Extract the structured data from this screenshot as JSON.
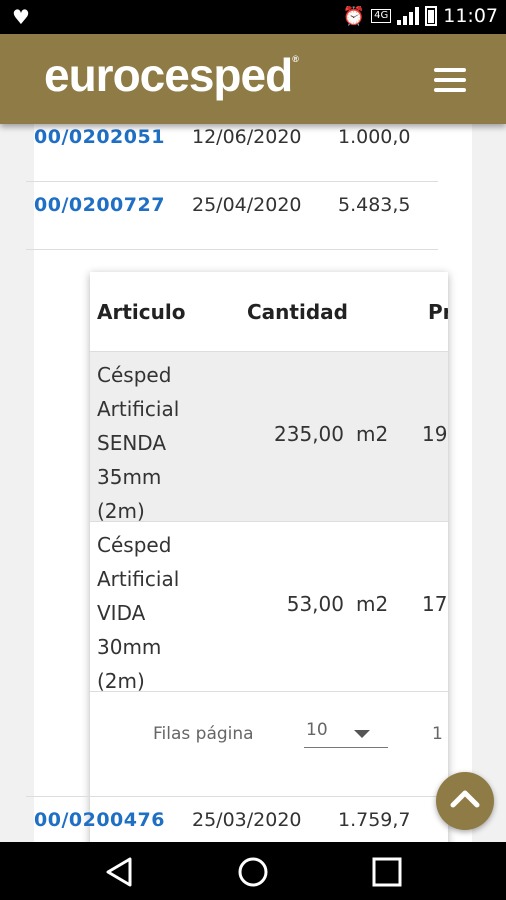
{
  "statusbar": {
    "time": "11:07",
    "network": "4G"
  },
  "header": {
    "brand": "eurocesped",
    "registered_mark": "®"
  },
  "orders": [
    {
      "number": "00/0202051",
      "date": "12/06/2020",
      "amount": "1.000,0"
    },
    {
      "number": "00/0200727",
      "date": "25/04/2020",
      "amount": "5.483,5"
    },
    {
      "number": "00/0200476",
      "date": "25/03/2020",
      "amount": "1.759,7"
    }
  ],
  "detail": {
    "columns": {
      "articulo": "Articulo",
      "cantidad": "Cantidad",
      "precio": "Pr"
    },
    "items": [
      {
        "lines": [
          "Césped",
          "Artificial",
          "SENDA",
          "35mm",
          "(2m)"
        ],
        "quantity": "235,00",
        "unit": "m2",
        "price": "19"
      },
      {
        "lines": [
          "Césped",
          "Artificial",
          "VIDA",
          "30mm",
          "(2m)"
        ],
        "quantity": "53,00",
        "unit": "m2",
        "price": "17"
      }
    ],
    "pagination": {
      "rows_label": "Filas página",
      "rows_value": "10",
      "range": "1"
    }
  },
  "colors": {
    "brand": "#8f7b45",
    "link": "#1f6fc5"
  },
  "icons": {
    "fab": "chevron-up-icon",
    "menu": "hamburger-menu-icon"
  }
}
